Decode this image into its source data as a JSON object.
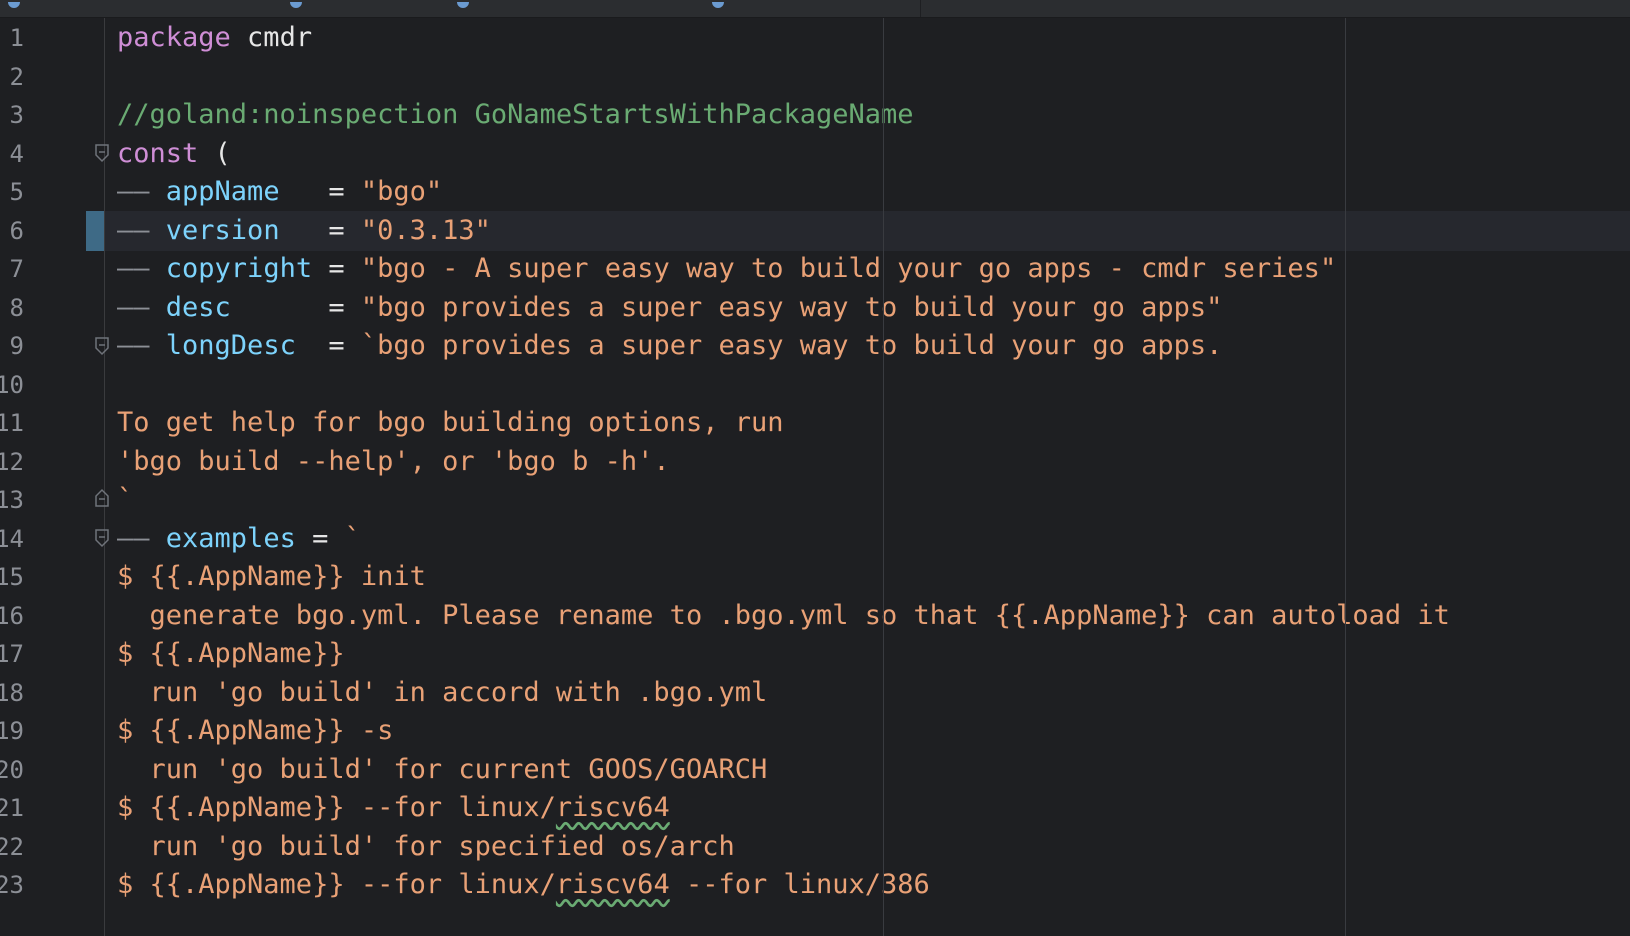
{
  "tabs": [
    {
      "label": ""
    },
    {
      "label": ""
    },
    {
      "label": ""
    },
    {
      "label": ""
    }
  ],
  "line_numbers": [
    "1",
    "2",
    "3",
    "4",
    "5",
    "6",
    "7",
    "8",
    "9",
    "10",
    "11",
    "12",
    "13",
    "14",
    "15",
    "16",
    "17",
    "18",
    "19",
    "20",
    "21",
    "22",
    "23"
  ],
  "code": {
    "l1_kw": "package",
    "l1_name": " cmdr",
    "l3_comment": "//goland:noinspection GoNameStartsWithPackageName",
    "l4_kw": "const",
    "l4_rest": " (",
    "l5_dash": "—— ",
    "l5_ident": "appName",
    "l5_op": "   = ",
    "l5_str": "\"bgo\"",
    "l6_dash": "—— ",
    "l6_ident": "version",
    "l6_op": "   = ",
    "l6_str": "\"0.3.13\"",
    "l7_dash": "—— ",
    "l7_ident": "copyright",
    "l7_op": " = ",
    "l7_str": "\"bgo - A super easy way to build your go apps - cmdr series\"",
    "l8_dash": "—— ",
    "l8_ident": "desc",
    "l8_op": "      = ",
    "l8_str": "\"bgo provides a super easy way to build your go apps\"",
    "l9_dash": "—— ",
    "l9_ident": "longDesc",
    "l9_op": "  = ",
    "l9_str": "`bgo provides a super easy way to build your go apps.",
    "l11": "To get help for bgo building options, run",
    "l12": "'bgo build --help', or 'bgo b -h'.",
    "l13": "`",
    "l14_dash": "—— ",
    "l14_ident": "examples",
    "l14_op": " = ",
    "l14_str": "`",
    "l15": "$ {{.AppName}} init",
    "l16": "  generate bgo.yml. Please rename to .bgo.yml so that {{.AppName}} can autoload it",
    "l17": "$ {{.AppName}}",
    "l18": "  run 'go build' in accord with .bgo.yml",
    "l19": "$ {{.AppName}} -s",
    "l20": "  run 'go build' for current GOOS/GOARCH",
    "l21_a": "$ {{.AppName}} --for linux/",
    "l21_b": "riscv64",
    "l22": "  run 'go build' for specified os/arch",
    "l23_a": "$ {{.AppName}} --for linux/",
    "l23_b": "riscv64",
    "l23_c": " --for linux/386"
  },
  "colors": {
    "keyword": "#cf8ed6",
    "comment": "#6aab73",
    "identifier": "#7dd3fc",
    "string": "#e9a176",
    "background": "#1e1f22"
  }
}
